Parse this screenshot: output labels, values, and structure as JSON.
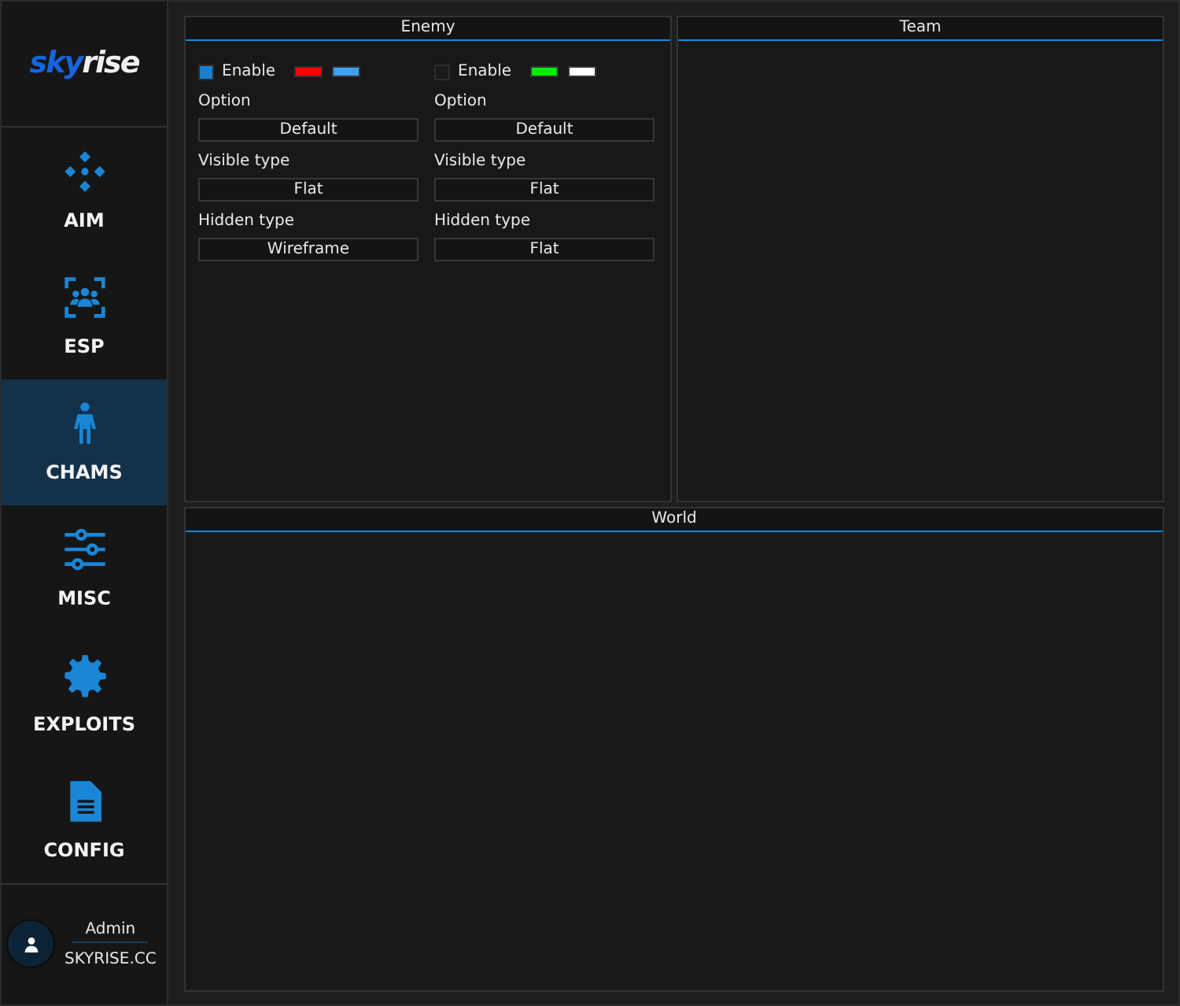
{
  "logo": {
    "first_part": "sky",
    "second_part": "rise"
  },
  "nav": [
    {
      "label": "AIM",
      "kind": "crosshair",
      "selected": false
    },
    {
      "label": "ESP",
      "kind": "group",
      "selected": false
    },
    {
      "label": "CHAMS",
      "kind": "person",
      "selected": true
    },
    {
      "label": "MISC",
      "kind": "sliders",
      "selected": false
    },
    {
      "label": "EXPLOITS",
      "kind": "gear",
      "selected": false
    },
    {
      "label": "CONFIG",
      "kind": "file",
      "selected": false
    }
  ],
  "user": {
    "name": "Admin",
    "site": "SKYRISE.CC"
  },
  "panels": [
    {
      "title": "Enemy",
      "columns": [
        {
          "enable": {
            "label": "Enable",
            "checked": true
          },
          "colors": [
            {
              "color": "#ff0000"
            },
            {
              "color": "#3fa0f0"
            }
          ],
          "fields": [
            {
              "label": "Option",
              "dropdown": "Default"
            },
            {
              "label": "Visible type",
              "dropdown": "Flat"
            },
            {
              "label": "Hidden type",
              "dropdown": "Wireframe"
            }
          ]
        },
        {
          "enable": {
            "label": "Enable",
            "checked": false
          },
          "colors": [
            {
              "color": "#00ee00"
            },
            {
              "color": "#ffffff"
            }
          ],
          "fields": [
            {
              "label": "Option",
              "dropdown": "Default"
            },
            {
              "label": "Visible type",
              "dropdown": "Flat"
            },
            {
              "label": "Hidden type",
              "dropdown": "Flat"
            }
          ]
        }
      ]
    },
    {
      "title": "Team"
    }
  ],
  "world": {
    "title": "World"
  }
}
